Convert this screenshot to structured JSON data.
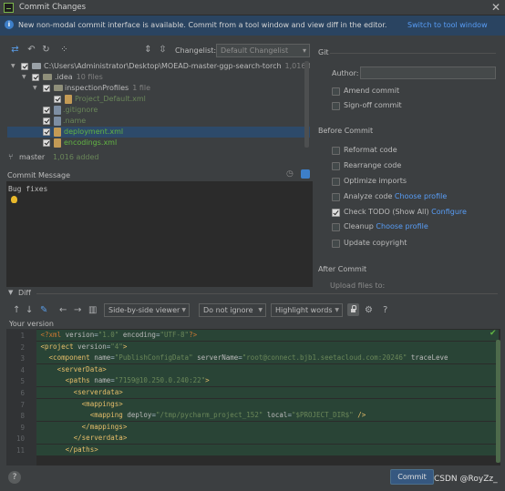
{
  "window": {
    "title": "Commit Changes",
    "close": "✕"
  },
  "banner": {
    "icon": "info-icon",
    "text": "New non-modal commit interface is available. Commit from a tool window and view diff in the editor.",
    "link": "Switch to tool window"
  },
  "toolbar": {
    "changelist_label": "Changelist:",
    "changelist_value": "Default Changelist"
  },
  "tree": [
    {
      "name": "C:\\Users\\Administrator\\Desktop\\MOEAD-master-ggp-search-torch",
      "count": "1,016 files"
    },
    {
      "name": ".idea",
      "count": "10 files"
    },
    {
      "name": "inspectionProfiles",
      "count": "1 file"
    },
    {
      "name": "Project_Default.xml",
      "count": ""
    },
    {
      "name": ".gitignore",
      "count": ""
    },
    {
      "name": ".name",
      "count": ""
    },
    {
      "name": "deployment.xml",
      "count": ""
    },
    {
      "name": "encodings.xml",
      "count": ""
    }
  ],
  "branch": {
    "name": "master",
    "added": "1,016 added"
  },
  "commit_message": {
    "label": "Commit Message",
    "text": "Bug fixes"
  },
  "git": {
    "header": "Git",
    "author_label": "Author:",
    "author_value": "",
    "amend": "Amend commit",
    "signoff": "Sign-off commit"
  },
  "before_commit": {
    "header": "Before Commit",
    "reformat": "Reformat code",
    "rearrange": "Rearrange code",
    "optimize": "Optimize imports",
    "analyze": "Analyze code",
    "analyze_link": "Choose profile",
    "todo": "Check TODO (Show All)",
    "todo_link": "Configure",
    "cleanup": "Cleanup",
    "cleanup_link": "Choose profile",
    "copyright": "Update copyright"
  },
  "after_commit": {
    "header": "After Commit",
    "upload": "Upload files to:"
  },
  "diff": {
    "label": "Diff",
    "viewer": "Side-by-side viewer",
    "ignore": "Do not ignore",
    "highlight": "Highlight words",
    "your_version": "Your version",
    "help": "?"
  },
  "code_lines": [
    {
      "n": "1",
      "html": "<span class='pi'>&lt;?xml</span> <span class='a'>version</span>=<span class='v'>\"1.0\"</span> <span class='a'>encoding</span>=<span class='v'>\"UTF-8\"</span><span class='pi'>?&gt;</span>"
    },
    {
      "n": "2",
      "html": "<span class='t'>&lt;project</span> <span class='a'>version</span>=<span class='v'>\"4\"</span><span class='t'>&gt;</span>"
    },
    {
      "n": "3",
      "html": "  <span class='t'>&lt;component</span> <span class='a'>name</span>=<span class='v'>\"PublishConfigData\"</span> <span class='a'>serverName</span>=<span class='v'>\"root@connect.bjb1.seetacloud.com:20246\"</span> <span class='a'>traceLeve</span>"
    },
    {
      "n": "4",
      "html": "    <span class='t'>&lt;serverData&gt;</span>"
    },
    {
      "n": "5",
      "html": "      <span class='t'>&lt;paths</span> <span class='a'>name</span>=<span class='v'>\"7159@10.250.0.240:22\"</span><span class='t'>&gt;</span>"
    },
    {
      "n": "6",
      "html": "        <span class='t'>&lt;serverdata&gt;</span>"
    },
    {
      "n": "7",
      "html": "          <span class='t'>&lt;mappings&gt;</span>"
    },
    {
      "n": "8",
      "html": "            <span class='t'>&lt;mapping</span> <span class='a'>deploy</span>=<span class='v'>\"/tmp/pycharm_project_152\"</span> <span class='a'>local</span>=<span class='v'>\"$PROJECT_DIR$\"</span> <span class='t'>/&gt;</span>"
    },
    {
      "n": "9",
      "html": "          <span class='t'>&lt;/mappings&gt;</span>"
    },
    {
      "n": "10",
      "html": "        <span class='t'>&lt;/serverdata&gt;</span>"
    },
    {
      "n": "11",
      "html": "      <span class='t'>&lt;/paths&gt;</span>"
    }
  ],
  "buttons": {
    "commit": "Commit",
    "help": "?"
  },
  "watermark": "CSDN @RoyZz_",
  "colors": {
    "accent": "#365880",
    "link": "#589df6",
    "added": "#294436",
    "banner": "#2a4461"
  }
}
